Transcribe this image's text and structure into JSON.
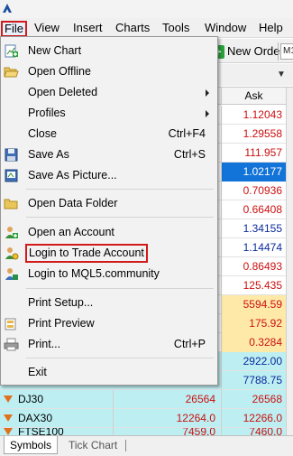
{
  "app": {
    "logo_icon": "metatrader-logo-icon"
  },
  "menubar": {
    "items": [
      {
        "label": "File",
        "active": true
      },
      {
        "label": "View"
      },
      {
        "label": "Insert"
      },
      {
        "label": "Charts"
      },
      {
        "label": "Tools"
      },
      {
        "label": "Window"
      },
      {
        "label": "Help"
      }
    ]
  },
  "toolbar": {
    "new_order_label": "New Order",
    "timeframe_label": "M1",
    "accent_color": "#2aa13b"
  },
  "file_menu": {
    "items": [
      {
        "label": "New Chart",
        "icon": "new-chart-icon"
      },
      {
        "label": "Open Offline",
        "icon": "open-folder-icon"
      },
      {
        "label": "Open Deleted",
        "submenu": true
      },
      {
        "label": "Profiles",
        "submenu": true
      },
      {
        "label": "Close",
        "shortcut": "Ctrl+F4"
      },
      {
        "label": "Save As",
        "shortcut": "Ctrl+S",
        "icon": "save-icon"
      },
      {
        "label": "Save As Picture...",
        "icon": "save-picture-icon"
      },
      {
        "label": "Open Data Folder",
        "icon": "folder-icon"
      },
      {
        "label": "Open an Account",
        "icon": "open-account-icon"
      },
      {
        "label": "Login to Trade Account",
        "icon": "login-icon",
        "highlighted": true
      },
      {
        "label": "Login to MQL5.community",
        "icon": "mql5-login-icon"
      },
      {
        "label": "Print Setup..."
      },
      {
        "label": "Print Preview",
        "icon": "print-preview-icon"
      },
      {
        "label": "Print...",
        "shortcut": "Ctrl+P",
        "icon": "print-icon"
      },
      {
        "label": "Exit"
      }
    ]
  },
  "market_watch": {
    "ask_header": "Ask",
    "rows": [
      {
        "symbol": "",
        "bid": "",
        "ask": "1.12043"
      },
      {
        "symbol": "",
        "bid": "",
        "ask": "1.29558"
      },
      {
        "symbol": "",
        "bid": "",
        "ask": "111.957"
      },
      {
        "symbol": "",
        "bid": "",
        "ask": "1.02177"
      },
      {
        "symbol": "",
        "bid": "",
        "ask": "0.70936"
      },
      {
        "symbol": "",
        "bid": "",
        "ask": "0.66408"
      },
      {
        "symbol": "",
        "bid": "",
        "ask": "1.34155"
      },
      {
        "symbol": "",
        "bid": "",
        "ask": "1.14474"
      },
      {
        "symbol": "",
        "bid": "",
        "ask": "0.86493"
      },
      {
        "symbol": "",
        "bid": "",
        "ask": "125.435"
      },
      {
        "symbol": "",
        "bid": "",
        "ask": "5594.59"
      },
      {
        "symbol": "",
        "bid": "",
        "ask": "175.92"
      },
      {
        "symbol": "",
        "bid": "",
        "ask": "0.3284"
      },
      {
        "symbol": "",
        "bid": "",
        "ask": "2922.00"
      },
      {
        "symbol": "",
        "bid": "",
        "ask": "7788.75"
      },
      {
        "symbol": "DJ30",
        "bid": "26564",
        "ask": "26568"
      },
      {
        "symbol": "DAX30",
        "bid": "12264.0",
        "ask": "12266.0"
      },
      {
        "symbol": "FTSE100",
        "bid": "7459.0",
        "ask": "7460.0"
      }
    ]
  },
  "tabs": [
    {
      "label": "Symbols",
      "active": true
    },
    {
      "label": "Tick Chart"
    }
  ]
}
